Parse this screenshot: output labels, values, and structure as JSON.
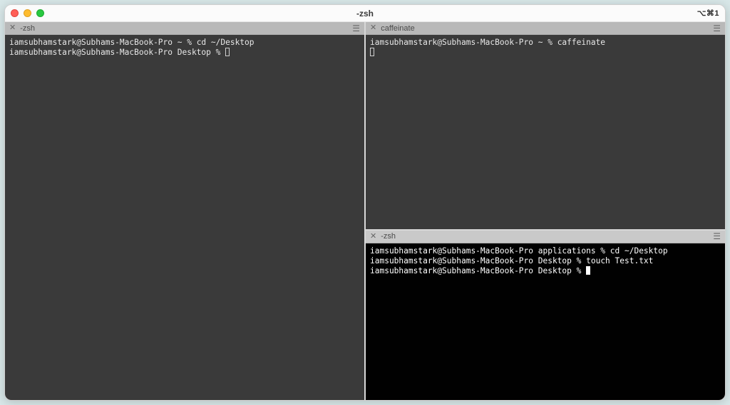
{
  "window": {
    "title": "-zsh",
    "shortcut": "⌥⌘1"
  },
  "panes": {
    "left": {
      "tab_title": "-zsh",
      "lines": {
        "l1_prompt": "iamsubhamstark@Subhams-MacBook-Pro ~ % ",
        "l1_cmd": "cd ~/Desktop",
        "l2_prompt": "iamsubhamstark@Subhams-MacBook-Pro Desktop % "
      }
    },
    "topRight": {
      "tab_title": "caffeinate",
      "lines": {
        "l1_prompt": "iamsubhamstark@Subhams-MacBook-Pro ~ % ",
        "l1_cmd": "caffeinate"
      }
    },
    "bottomRight": {
      "tab_title": "-zsh",
      "lines": {
        "l1_prompt": "iamsubhamstark@Subhams-MacBook-Pro applications % ",
        "l1_cmd": "cd ~/Desktop",
        "l2_prompt": "iamsubhamstark@Subhams-MacBook-Pro Desktop % ",
        "l2_cmd": "touch Test.txt",
        "l3_prompt": "iamsubhamstark@Subhams-MacBook-Pro Desktop % "
      }
    }
  }
}
